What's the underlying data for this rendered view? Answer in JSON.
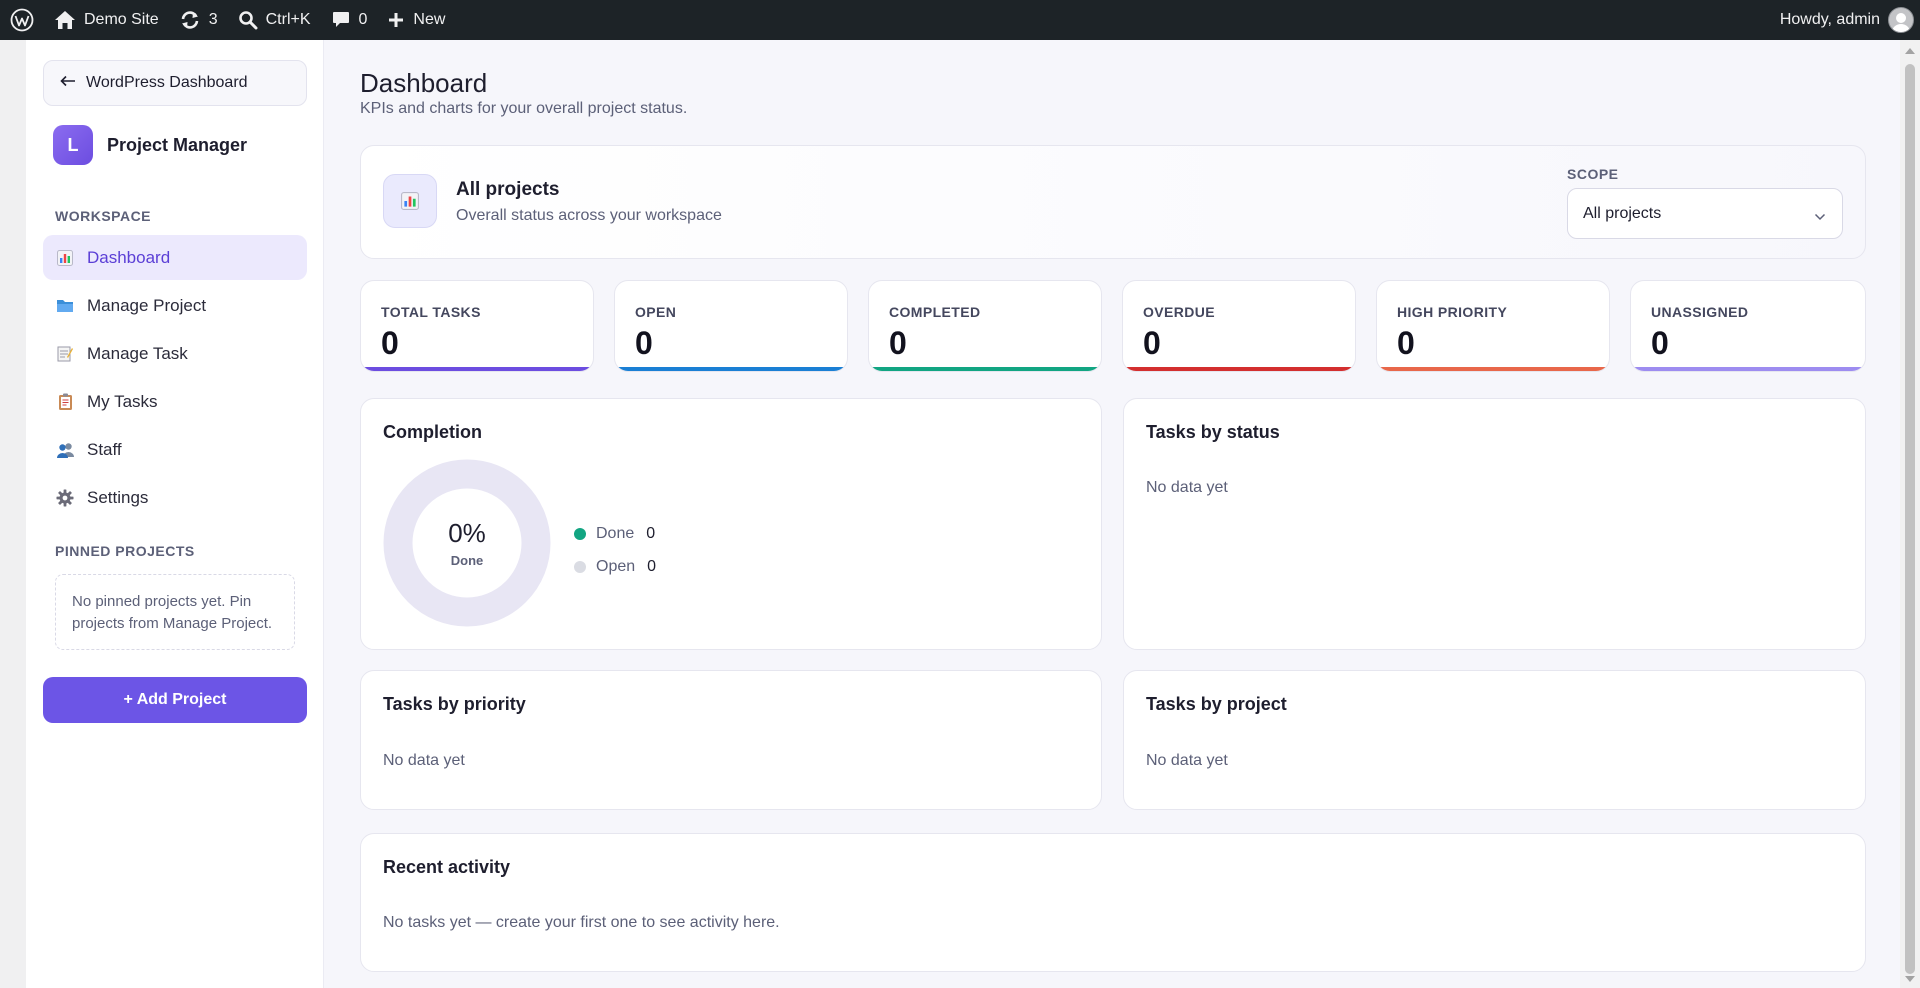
{
  "admin_bar": {
    "site_name": "Demo Site",
    "updates_count": "3",
    "search_shortcut": "Ctrl+K",
    "comments_count": "0",
    "new_label": "New",
    "howdy": "Howdy, admin"
  },
  "sidebar": {
    "back_label": "WordPress Dashboard",
    "brand_initial": "L",
    "brand_name": "Project Manager",
    "workspace_label": "WORKSPACE",
    "items": [
      {
        "label": "Dashboard",
        "icon": "bar-chart-icon",
        "active": true
      },
      {
        "label": "Manage Project",
        "icon": "folder-icon",
        "active": false
      },
      {
        "label": "Manage Task",
        "icon": "memo-icon",
        "active": false
      },
      {
        "label": "My Tasks",
        "icon": "clipboard-icon",
        "active": false
      },
      {
        "label": "Staff",
        "icon": "people-icon",
        "active": false
      },
      {
        "label": "Settings",
        "icon": "gear-icon",
        "active": false
      }
    ],
    "pinned_label": "PINNED PROJECTS",
    "pinned_empty": "No pinned projects yet. Pin projects from Manage Project.",
    "add_project_label": "+ Add Project"
  },
  "header": {
    "title": "Dashboard",
    "subtitle": "KPIs and charts for your overall project status."
  },
  "scope": {
    "title": "All projects",
    "subtitle": "Overall status across your workspace",
    "label": "SCOPE",
    "selected": "All projects"
  },
  "kpis": [
    {
      "label": "TOTAL TASKS",
      "value": "0",
      "color": "#6c4de0"
    },
    {
      "label": "OPEN",
      "value": "0",
      "color": "#1a7fd4"
    },
    {
      "label": "COMPLETED",
      "value": "0",
      "color": "#12a582"
    },
    {
      "label": "OVERDUE",
      "value": "0",
      "color": "#d32f2f"
    },
    {
      "label": "HIGH PRIORITY",
      "value": "0",
      "color": "#e8674a"
    },
    {
      "label": "UNASSIGNED",
      "value": "0",
      "color": "#9d8cf0"
    }
  ],
  "completion": {
    "title": "Completion",
    "percent": "0%",
    "center_label": "Done",
    "legend": [
      {
        "label": "Done",
        "value": "0",
        "color": "#12a582"
      },
      {
        "label": "Open",
        "value": "0",
        "color": "#dadce3"
      }
    ]
  },
  "status_panel": {
    "title": "Tasks by status",
    "empty": "No data yet"
  },
  "priority_panel": {
    "title": "Tasks by priority",
    "empty": "No data yet"
  },
  "project_panel": {
    "title": "Tasks by project",
    "empty": "No data yet"
  },
  "activity": {
    "title": "Recent activity",
    "empty": "No tasks yet — create your first one to see activity here."
  }
}
